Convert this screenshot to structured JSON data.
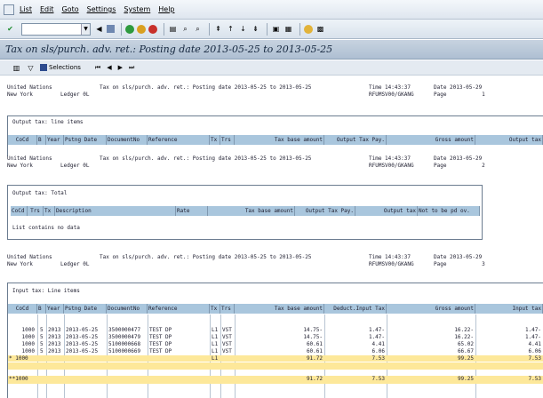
{
  "menu": [
    "List",
    "Edit",
    "Goto",
    "Settings",
    "System",
    "Help"
  ],
  "title": "Tax on sls/purch. adv. ret.: Posting date 2013-05-25 to 2013-05-25",
  "app_toolbar": {
    "selections_label": "Selections"
  },
  "page_header": {
    "company": "United Nations",
    "city": "New York",
    "ledger": "Ledger 0L",
    "report_title": "Tax on sls/purch. adv. ret.: Posting date 2013-05-25 to 2013-05-25",
    "time": "Time 14:43:37",
    "date": "Date 2013-05-29",
    "program": "RFUMSV00/GKANG",
    "page1": "Page           1",
    "page2": "Page           2",
    "page3": "Page           3"
  },
  "section1": {
    "title": "Output tax: line items",
    "columns": [
      "CoCd",
      "B",
      "Year",
      "Pstng Date",
      "DocumentNo",
      "Reference",
      "Tx",
      "Trs",
      "Tax base amount",
      "Output Tax Pay.",
      "Gross amount",
      "Output tax"
    ]
  },
  "section2": {
    "title": "Output tax: Total",
    "columns": [
      "CoCd",
      "Trs",
      "Tx",
      "Description",
      "Rate",
      "Tax base amount",
      "Output Tax Pay.",
      "Output tax",
      "Not to be pd ov."
    ],
    "empty_text": "List contains no data"
  },
  "section3": {
    "title": "Input tax: Line items",
    "columns": [
      "CoCd",
      "B",
      "Year",
      "Pstng Date",
      "DocumentNo",
      "Reference",
      "Tx",
      "Trs",
      "Tax base amount",
      "Deduct.Input Tax",
      "Gross amount",
      "Input tax"
    ],
    "rows": [
      {
        "cocd": "1000",
        "b": "5",
        "year": "2013",
        "date": "2013-05-25",
        "doc": "3500000477",
        "ref": "TEST DP",
        "tx": "L1",
        "trs": "VST",
        "base": "14.75-",
        "ded": "1.47-",
        "gross": "16.22-",
        "input": "1.47-"
      },
      {
        "cocd": "1000",
        "b": "5",
        "year": "2013",
        "date": "2013-05-25",
        "doc": "3500000479",
        "ref": "TEST DP",
        "tx": "L1",
        "trs": "VST",
        "base": "14.75-",
        "ded": "1.47-",
        "gross": "16.22-",
        "input": "1.47-"
      },
      {
        "cocd": "1000",
        "b": "5",
        "year": "2013",
        "date": "2013-05-25",
        "doc": "5100000668",
        "ref": "TEST DP",
        "tx": "L1",
        "trs": "VST",
        "base": "60.61",
        "ded": "4.41",
        "gross": "65.02",
        "input": "4.41"
      },
      {
        "cocd": "1000",
        "b": "5",
        "year": "2013",
        "date": "2013-05-25",
        "doc": "5100000669",
        "ref": "TEST DP",
        "tx": "L1",
        "trs": "VST",
        "base": "60.61",
        "ded": "6.06",
        "gross": "66.67",
        "input": "6.06"
      }
    ],
    "subtotal": {
      "cocd": "* 1000",
      "tx": "L1",
      "base": "91.72",
      "ded": "7.53",
      "gross": "99.25",
      "input": "7.53"
    },
    "total": {
      "cocd": "**1000",
      "base": "91.72",
      "ded": "7.53",
      "gross": "99.25",
      "input": "7.53"
    }
  }
}
